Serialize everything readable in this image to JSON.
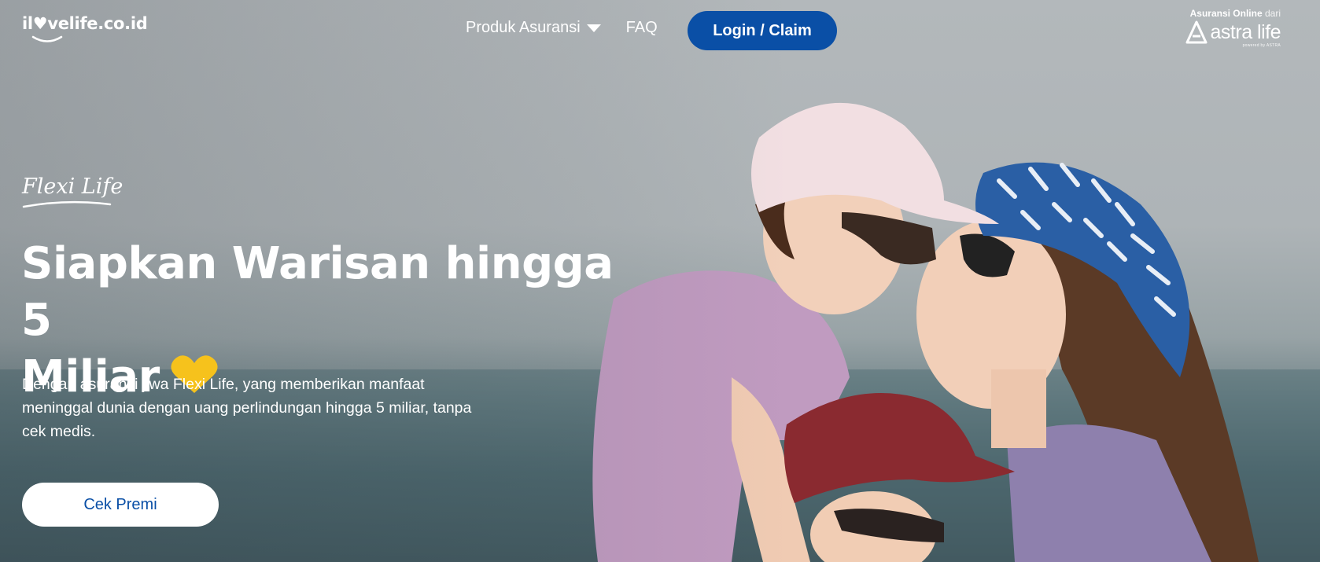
{
  "header": {
    "logo_text": "il♥velife.co.id",
    "nav": [
      {
        "label": "Produk Asuransi",
        "has_dropdown": true
      },
      {
        "label": "FAQ"
      }
    ],
    "login_label": "Login / Claim",
    "partner": {
      "tagline_main": "Asuransi Online",
      "tagline_suffix": "dari",
      "name": "astra life",
      "sub": "powered by ASTRA"
    }
  },
  "hero": {
    "product_name": "Flexi Life",
    "headline_line1": "Siapkan Warisan hingga 5",
    "headline_line2": "Miliar",
    "description": "Dengan asuransi jiwa Flexi Life, yang memberikan manfaat meninggal dunia dengan uang perlindungan hingga 5 miliar, tanpa cek medis.",
    "cta_label": "Cek Premi",
    "image_alt": "hero-family-photo"
  },
  "colors": {
    "primary": "#0a4fa6",
    "heart_accent": "#f6c21c",
    "text_light": "#ffffff"
  }
}
